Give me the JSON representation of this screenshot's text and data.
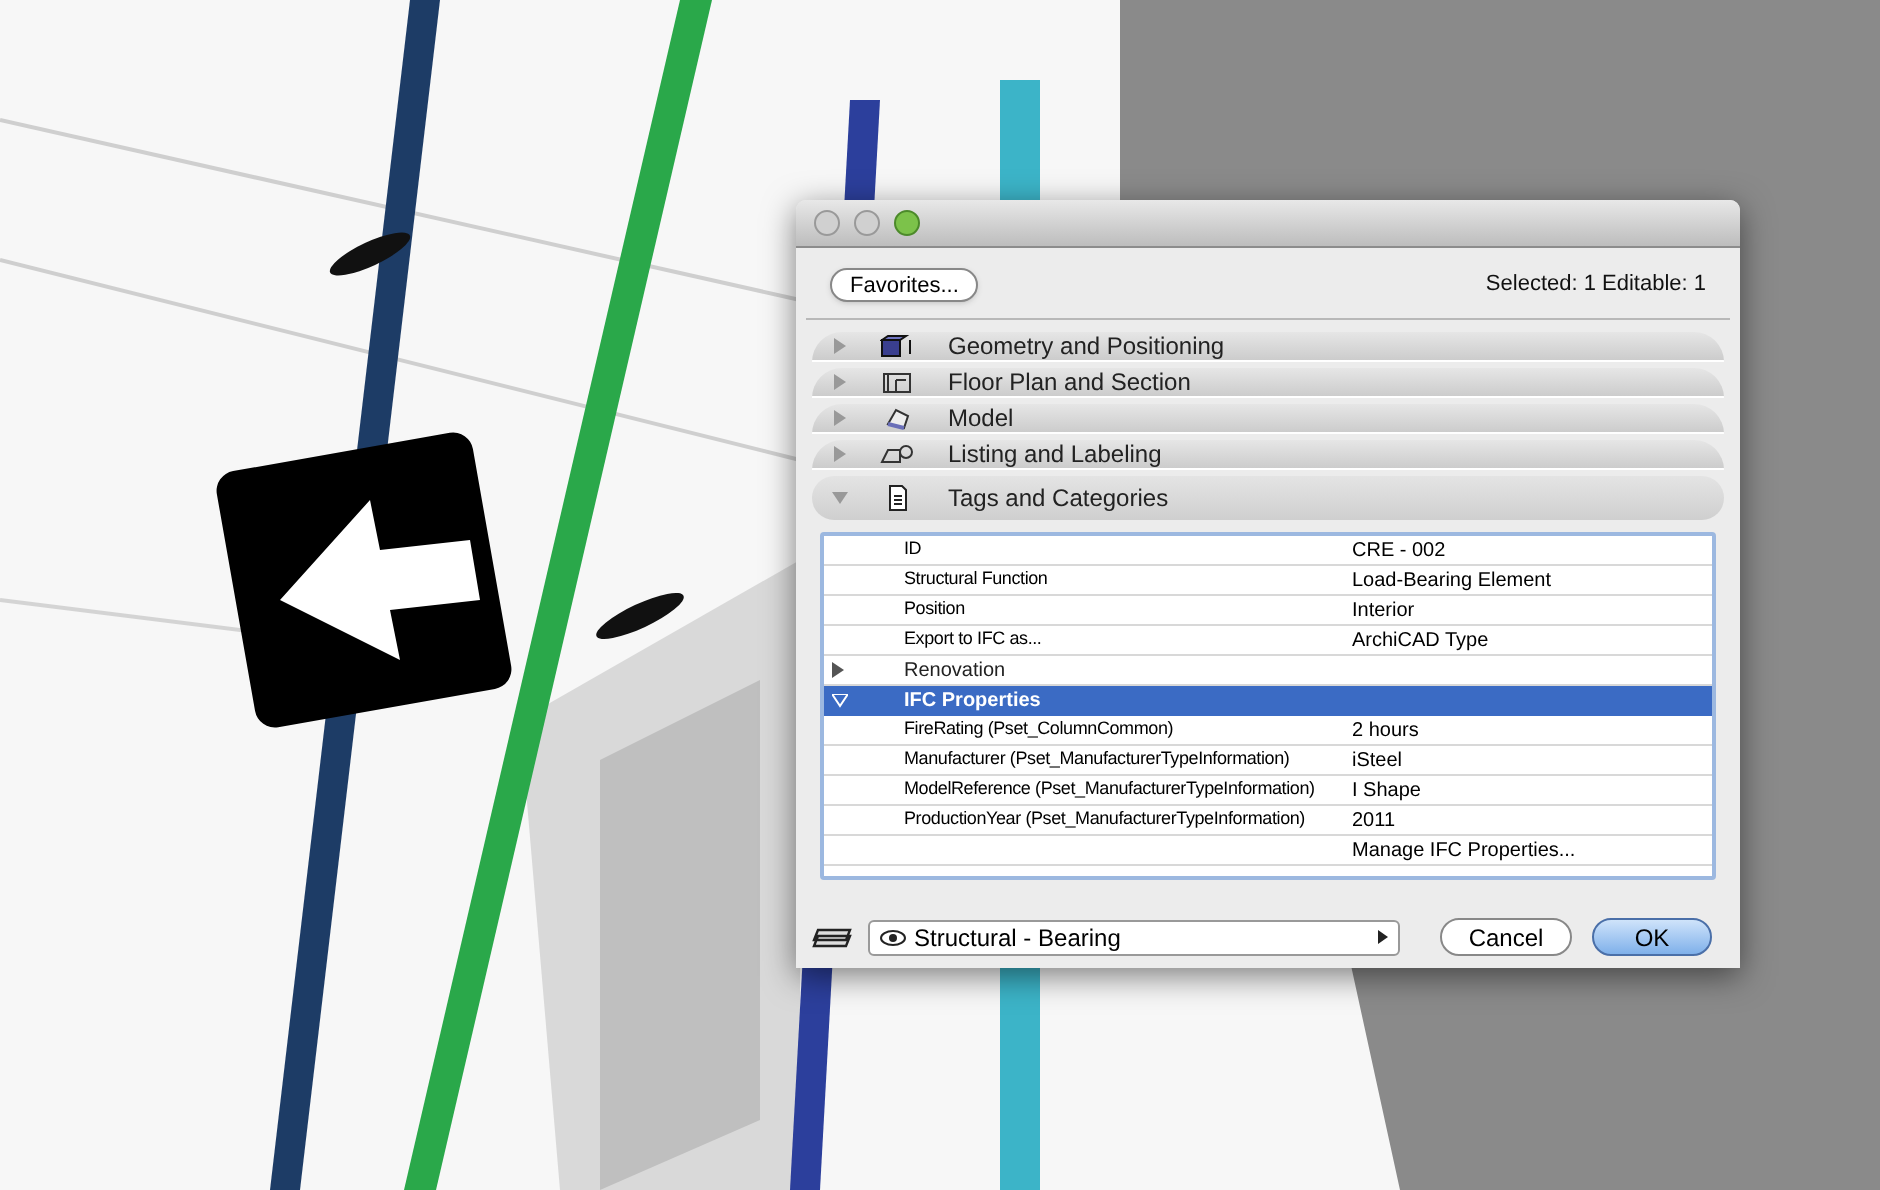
{
  "toolbar": {
    "favorites_button": "Favorites...",
    "selection_info": "Selected: 1 Editable: 1"
  },
  "panels": [
    {
      "label": "Geometry and Positioning",
      "expanded": false
    },
    {
      "label": "Floor Plan and Section",
      "expanded": false
    },
    {
      "label": "Model",
      "expanded": false
    },
    {
      "label": "Listing and Labeling",
      "expanded": false
    },
    {
      "label": "Tags and Categories",
      "expanded": true
    }
  ],
  "properties": [
    {
      "kind": "field",
      "name": "ID",
      "value": "CRE - 002"
    },
    {
      "kind": "field",
      "name": "Structural Function",
      "value": "Load-Bearing Element"
    },
    {
      "kind": "field",
      "name": "Position",
      "value": "Interior"
    },
    {
      "kind": "field",
      "name": "Export to IFC as...",
      "value": "ArchiCAD Type"
    },
    {
      "kind": "group",
      "label": "Renovation",
      "expanded": false,
      "selected": false
    },
    {
      "kind": "group",
      "label": "IFC Properties",
      "expanded": true,
      "selected": true
    },
    {
      "kind": "field",
      "name": "FireRating (Pset_ColumnCommon)",
      "value": "2 hours"
    },
    {
      "kind": "field",
      "name": "Manufacturer (Pset_ManufacturerTypeInformation)",
      "value": "iSteel"
    },
    {
      "kind": "field",
      "name": "ModelReference (Pset_ManufacturerTypeInformation)",
      "value": "I Shape"
    },
    {
      "kind": "field",
      "name": "ProductionYear (Pset_ManufacturerTypeInformation)",
      "value": "2011"
    },
    {
      "kind": "action",
      "value": "Manage IFC Properties..."
    }
  ],
  "footer": {
    "layer": "Structural - Bearing",
    "buttons": [
      {
        "label": "Cancel",
        "default": false
      },
      {
        "label": "OK",
        "default": true
      }
    ]
  }
}
